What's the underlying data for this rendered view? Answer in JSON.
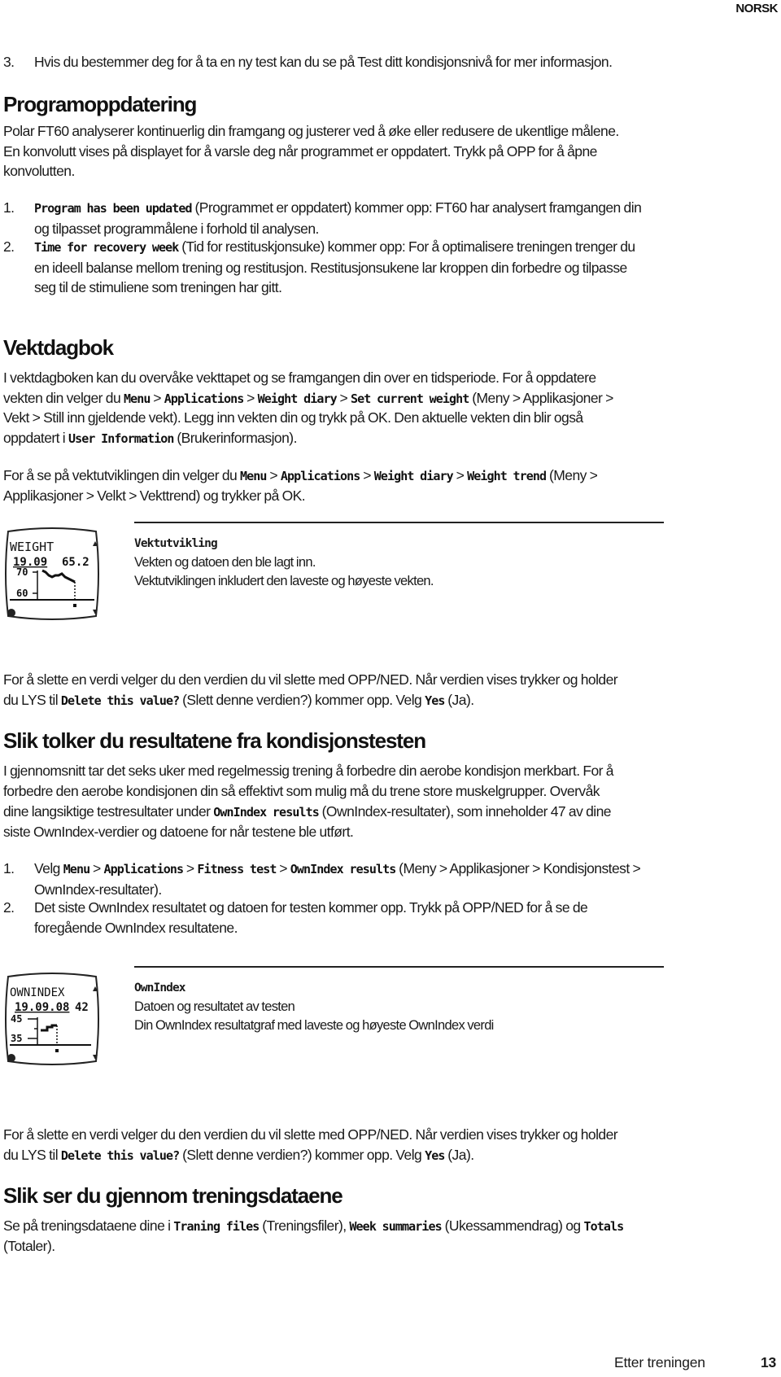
{
  "header": {
    "language": "NORSK"
  },
  "intro_item": {
    "number": "3.",
    "text": "Hvis du bestemmer deg for å ta en ny test kan du se på Test ditt kondisjonsnivå for mer informasjon."
  },
  "section_program_update": {
    "heading": "Programoppdatering",
    "paragraph_lines": [
      "Polar FT60 analyserer kontinuerlig din framgang og justerer ved å øke eller redusere de ukentlige målene.",
      "En konvolutt vises på displayet for å varsle deg når programmet er oppdatert. Trykk på OPP for å åpne",
      "konvolutten."
    ],
    "items": [
      {
        "number": "1.",
        "ui_label": "Program has been updated",
        "rest_line1": " (Programmet er oppdatert) kommer opp: FT60 har analysert framgangen din",
        "more_lines": [
          "og tilpasset programmålene i forhold til analysen."
        ]
      },
      {
        "number": "2.",
        "ui_label": "Time for recovery week",
        "rest_line1": " (Tid for restituskjonsuke) kommer opp: For å optimalisere treningen trenger du",
        "more_lines": [
          "en ideell balanse mellom trening og restitusjon. Restitusjonsukene lar kroppen din forbedre og tilpasse",
          "seg til de stimuliene som treningen har gitt."
        ]
      }
    ]
  },
  "section_weight_diary": {
    "heading": "Vektdagbok",
    "p1": {
      "line1": "I vektdagboken kan du overvåke vekttapet og se framgangen din over en tidsperiode. For å oppdatere",
      "line2_prefix": "vekten din velger du ",
      "path": [
        "Menu",
        "Applications",
        "Weight diary",
        "Set current weight"
      ],
      "separator": " > ",
      "line2_suffix": " (Meny > Applikasjoner >",
      "line3": "Vekt > Still inn gjeldende vekt). Legg inn vekten din og trykk på OK. Den aktuelle vekten din blir også",
      "line4_prefix": "oppdatert i ",
      "line4_ui": "User Information",
      "line4_suffix": " (Brukerinformasjon)."
    },
    "p2": {
      "line1_prefix": "For å se på vektutviklingen din velger du ",
      "path": [
        "Menu",
        "Applications",
        "Weight diary",
        "Weight trend"
      ],
      "line1_suffix": " (Meny >",
      "line2": "Applikasjoner > Velkt > Vekttrend) og trykker på OK."
    },
    "display": {
      "title": "WEIGHT",
      "date": "19.09",
      "value": "65.2",
      "y_high": "70",
      "y_low": "60"
    },
    "caption": {
      "title": "Vektutvikling",
      "line1": "Vekten og datoen den ble lagt inn.",
      "line2": "Vektutviklingen inkludert den laveste og høyeste vekten."
    },
    "delete": {
      "line1": "For å slette en verdi velger du den verdien du vil slette med OPP/NED. Når verdien vises trykker og holder",
      "line2_prefix": "du LYS til ",
      "ui_delete": "Delete this value?",
      "line2_mid": " (Slett denne verdien?) kommer opp. Velg ",
      "ui_yes": "Yes",
      "line2_suffix": " (Ja)."
    }
  },
  "section_fitness_results": {
    "heading": "Slik tolker du resultatene fra kondisjonstesten",
    "p1": {
      "line1": "I gjennomsnitt tar det seks uker med regelmessig trening å forbedre din aerobe kondisjon merkbart. For å",
      "line2": "forbedre den aerobe kondisjonen din så effektivt som mulig må du trene store muskelgrupper. Overvåk",
      "line3_prefix": "dine langsiktige testresultater under ",
      "line3_ui": "OwnIndex results",
      "line3_suffix": " (OwnIndex-resultater), som inneholder 47 av dine",
      "line4": "siste OwnIndex-verdier og datoene for når testene ble utført."
    },
    "steps": [
      {
        "number": "1.",
        "prefix": "Velg ",
        "path": [
          "Menu",
          "Applications",
          "Fitness test",
          "OwnIndex results"
        ],
        "suffix": " (Meny > Applikasjoner > Kondisjonstest >",
        "line2": "OwnIndex-resultater)."
      },
      {
        "number": "2.",
        "line1": "Det siste OwnIndex resultatet og datoen for testen kommer opp. Trykk på OPP/NED for å se de",
        "line2": "foregående OwnIndex resultatene."
      }
    ],
    "display": {
      "title": "OWNINDEX",
      "date": "19.09.08",
      "value": "42",
      "y_high": "45",
      "y_low": "35"
    },
    "caption": {
      "title": "OwnIndex",
      "line1": "Datoen og resultatet av testen",
      "line2": "Din OwnIndex resultatgraf med laveste og høyeste OwnIndex verdi"
    },
    "delete": {
      "line1": "For å slette en verdi velger du den verdien du vil slette med OPP/NED. Når verdien vises trykker og holder",
      "line2_prefix": "du LYS til ",
      "ui_delete": "Delete this value?",
      "line2_mid": " (Slett denne verdien?) kommer opp. Velg ",
      "ui_yes": "Yes",
      "line2_suffix": " (Ja)."
    }
  },
  "section_training_data": {
    "heading": "Slik ser du gjennom treningsdataene",
    "line1_prefix": "Se på treningsdataene dine i ",
    "ui1": "Traning files",
    "mid1": " (Treningsfiler), ",
    "ui2": "Week summaries",
    "mid2": " (Ukessammendrag) og ",
    "ui3": "Totals",
    "line2": "(Totaler)."
  },
  "footer": {
    "chapter": "Etter treningen",
    "page": "13"
  }
}
